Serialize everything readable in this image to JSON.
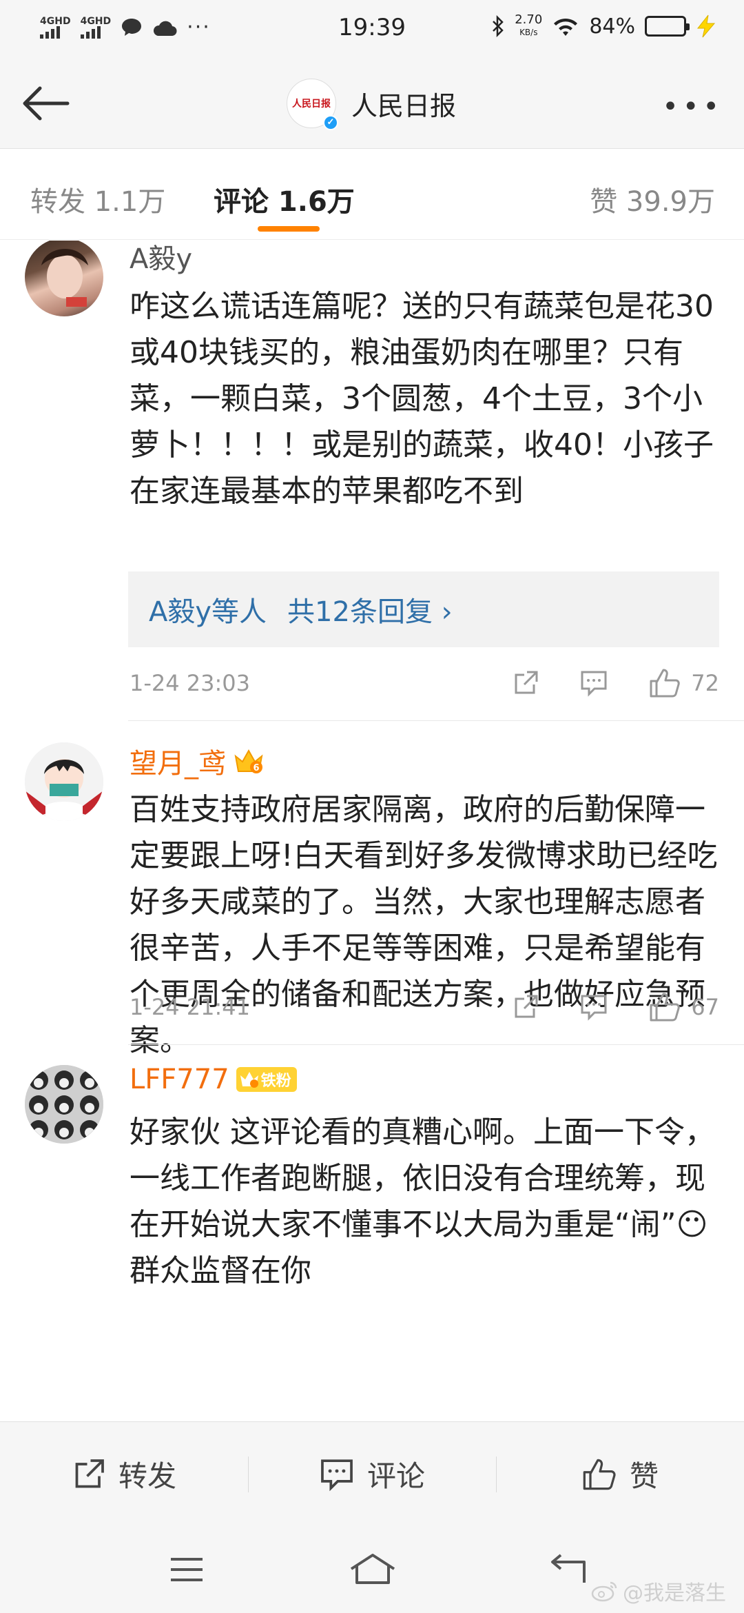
{
  "status_bar": {
    "network1": "4GHD",
    "network2": "4GHD",
    "time": "19:39",
    "speed_value": "2.70",
    "speed_unit": "KB/s",
    "battery": "84%",
    "battery_level": 0.84
  },
  "header": {
    "title": "人民日报",
    "logo_text": "人民日报"
  },
  "tabs": [
    {
      "label": "转发 1.1万"
    },
    {
      "label": "评论 1.6万"
    },
    {
      "label": "赞 39.9万"
    }
  ],
  "comments": [
    {
      "author": "A毅y",
      "text": "咋这么谎话连篇呢？送的只有蔬菜包是花30或40块钱买的，粮油蛋奶肉在哪里？只有菜，一颗白菜，3个圆葱，4个土豆，3个小萝卜！！！！或是别的蔬菜，收40！小孩子在家连最基本的苹果都吃不到",
      "reply_users": "A毅y等人",
      "reply_count": "共12条回复 ›",
      "time": "1-24 23:03",
      "likes": "72"
    },
    {
      "author": "望月_鸢",
      "text": "百姓支持政府居家隔离，政府的后勤保障一定要跟上呀!白天看到好多发微博求助已经吃好多天咸菜的了。当然，大家也理解志愿者很辛苦，人手不足等等困难，只是希望能有个更周全的储备和配送方案，也做好应急预案。",
      "time": "1-24 21:41",
      "likes": "67"
    },
    {
      "author": "LFF777",
      "fan_badge": "铁粉",
      "text": "好家伙 这评论看的真糟心啊。上面一下令，一线工作者跑断腿，依旧没有合理统筹，现在开始说大家不懂事不以大局为重是“闹”😶群众监督在你"
    }
  ],
  "action_bar": {
    "repost": "转发",
    "comment": "评论",
    "like": "赞"
  },
  "watermark": "@我是落生",
  "colors": {
    "accent": "#ff8200",
    "link": "#2f6fa8",
    "vip_name": "#f26e0e"
  }
}
